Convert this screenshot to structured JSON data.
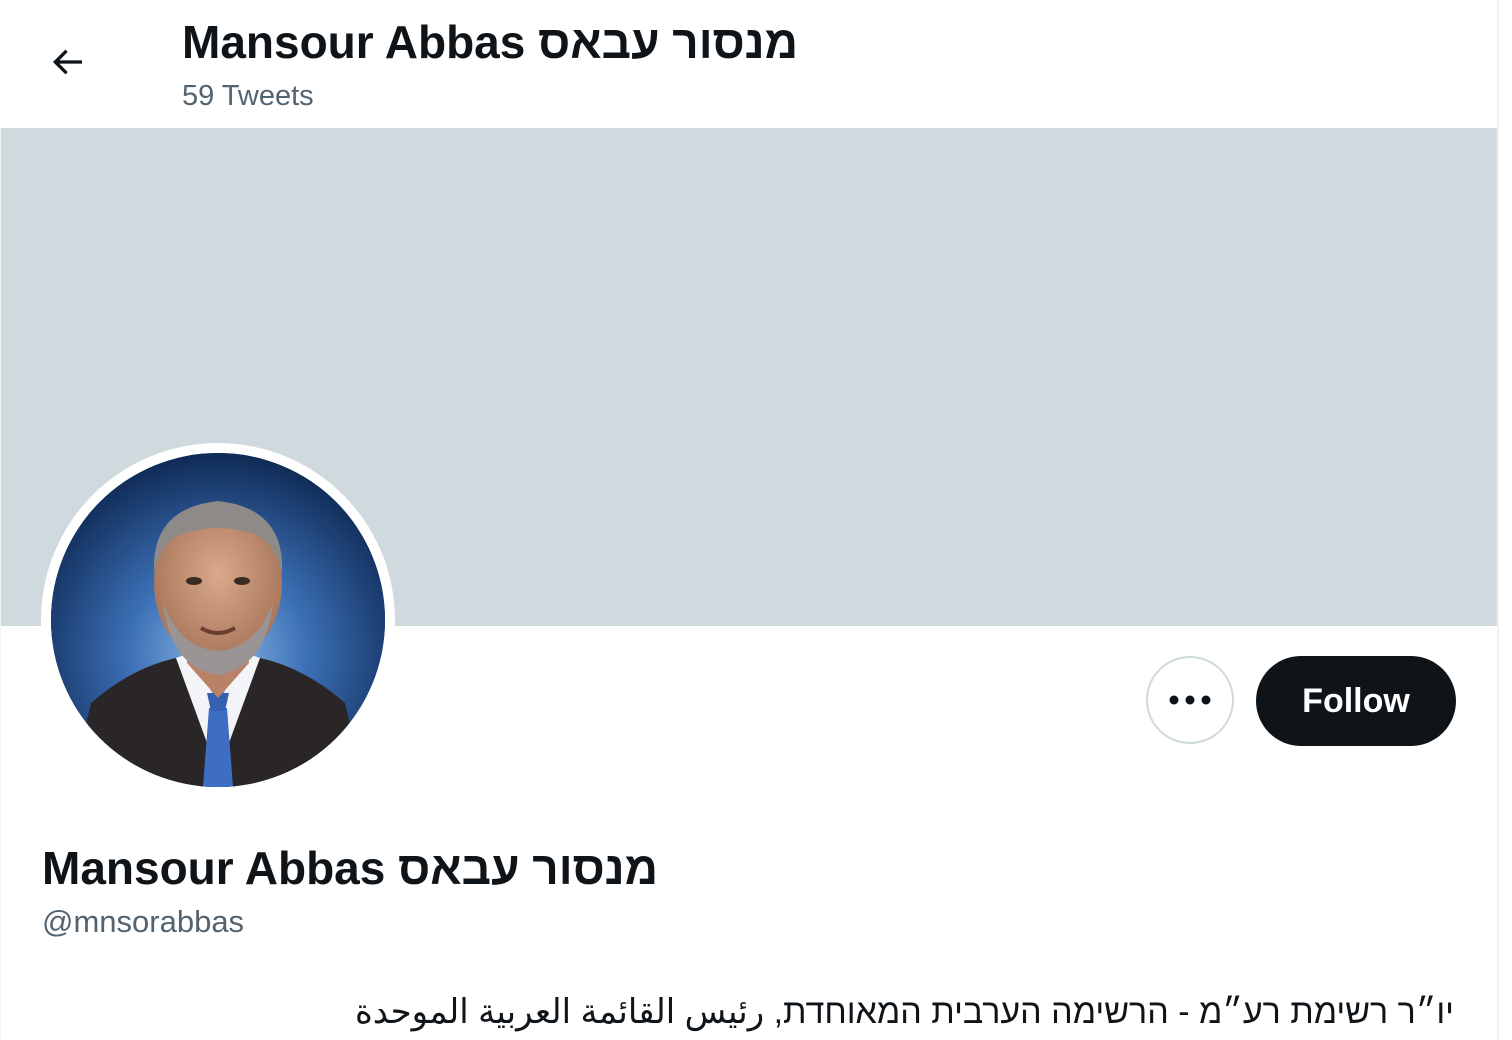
{
  "header": {
    "back_icon": "arrow-left-icon",
    "title": "Mansour Abbas מנסור עבאס",
    "tweet_count": "59 Tweets"
  },
  "banner": {
    "color": "#cfd9de"
  },
  "profile": {
    "name": "Mansour Abbas מנסור עבאס",
    "handle": "@mnsorabbas",
    "bio": "יו״ר רשימת רע״מ - הרשימה הערבית המאוחדת, رئيس القائمة العربية الموحدة"
  },
  "actions": {
    "more_icon": "more-horizontal-icon",
    "follow_label": "Follow"
  },
  "colors": {
    "text_primary": "#0f1419",
    "text_secondary": "#536471",
    "follow_bg": "#0f1419",
    "follow_text": "#ffffff",
    "border": "#cfd9de"
  }
}
